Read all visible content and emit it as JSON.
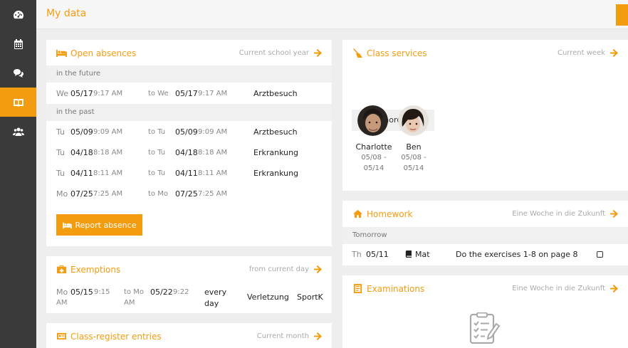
{
  "app": {
    "page_title": "My data"
  },
  "sidebar": {
    "items": [
      {
        "icon": "dashboard-icon",
        "active": false
      },
      {
        "icon": "calendar-icon",
        "active": false
      },
      {
        "icon": "chat-icon",
        "active": false
      },
      {
        "icon": "book-icon",
        "active": true
      },
      {
        "icon": "users-icon",
        "active": false
      }
    ]
  },
  "absences": {
    "title": "Open absences",
    "link": "Current school year",
    "future_label": "in the future",
    "past_label": "in the past",
    "future": [
      {
        "from_day": "We",
        "from_date": "05/17",
        "from_time": "9:17 AM",
        "to_prefix": "to We",
        "to_date": "05/17",
        "to_time": "9:17 AM",
        "reason": "Arztbesuch"
      }
    ],
    "past": [
      {
        "from_day": "Tu",
        "from_date": "05/09",
        "from_time": "9:09 AM",
        "to_prefix": "to Tu",
        "to_date": "05/09",
        "to_time": "9:09 AM",
        "reason": "Arztbesuch"
      },
      {
        "from_day": "Tu",
        "from_date": "04/18",
        "from_time": "8:18 AM",
        "to_prefix": "to Tu",
        "to_date": "04/18",
        "to_time": "8:18 AM",
        "reason": "Erkrankung"
      },
      {
        "from_day": "Tu",
        "from_date": "04/11",
        "from_time": "8:11 AM",
        "to_prefix": "to Tu",
        "to_date": "04/11",
        "to_time": "8:11 AM",
        "reason": "Erkrankung"
      },
      {
        "from_day": "Mo",
        "from_date": "07/25",
        "from_time": "7:25 AM",
        "to_prefix": "to Mo",
        "to_date": "07/25",
        "to_time": "7:25 AM",
        "reason": ""
      }
    ],
    "report_button": "Report absence"
  },
  "exemptions": {
    "title": "Exemptions",
    "link": "from current day",
    "row": {
      "from_day": "Mo",
      "from_date": "05/15",
      "from_time": "9:15",
      "from_ampm": "AM",
      "to_prefix": "to Mo",
      "to_date": "05/22",
      "to_time": "9:22",
      "to_ampm": "AM",
      "freq1": "every",
      "freq2": "day",
      "reason": "Verletzung",
      "subject": "SportK"
    }
  },
  "class_register": {
    "title": "Class-register entries",
    "link": "Current month"
  },
  "class_services": {
    "title": "Class services",
    "link": "Current week",
    "service": "Klassenordner",
    "people": [
      {
        "name": "Charlotte",
        "date1": "05/08 -",
        "date2": "05/14"
      },
      {
        "name": "Ben",
        "date1": "05/08 -",
        "date2": "05/14"
      }
    ]
  },
  "homework": {
    "title": "Homework",
    "link": "Eine Woche in die Zukunft",
    "group": "Tomorrow",
    "row": {
      "day": "Th",
      "date": "05/11",
      "subject": "Mat",
      "text": "Do the exercises 1-8 on page 8"
    }
  },
  "examinations": {
    "title": "Examinations",
    "link": "Eine Woche in die Zukunft"
  },
  "colors": {
    "accent": "#f49c10",
    "sidebar": "#3a3a3a",
    "background": "#eeeeee"
  }
}
